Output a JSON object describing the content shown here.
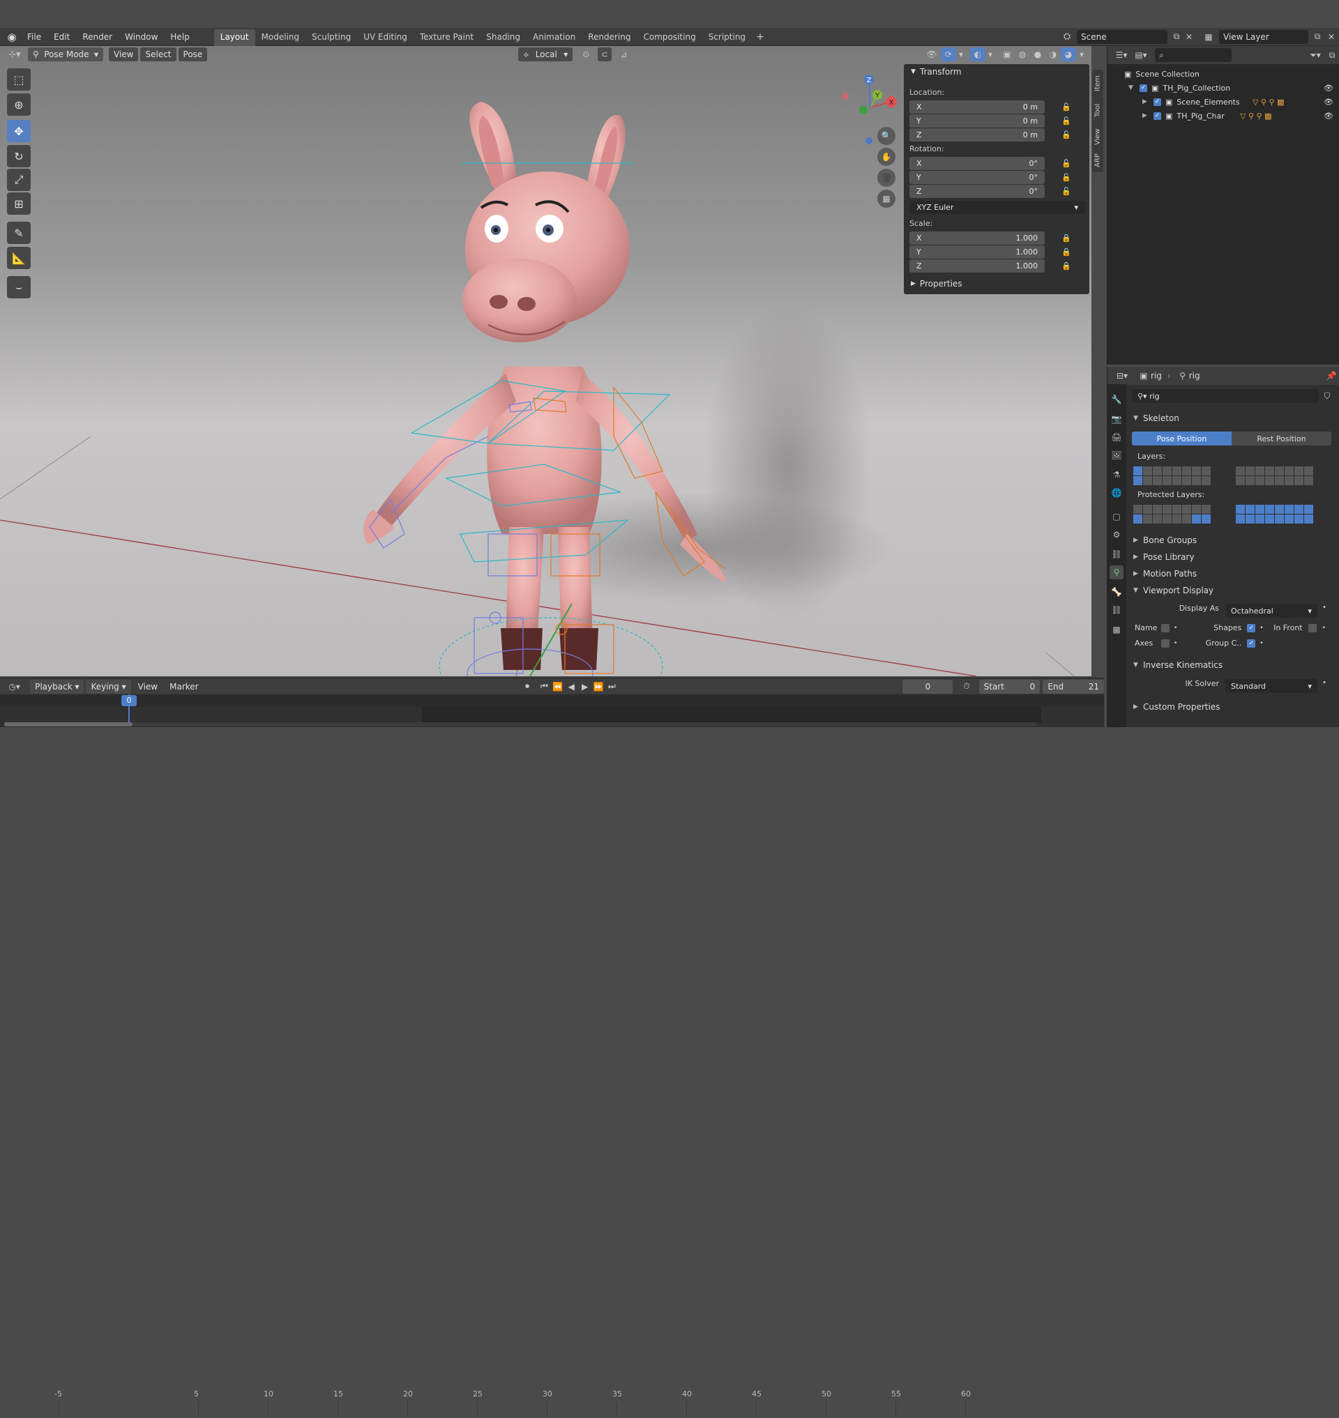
{
  "menus": [
    "File",
    "Edit",
    "Render",
    "Window",
    "Help"
  ],
  "workspaces": [
    {
      "label": "Layout",
      "active": true
    },
    {
      "label": "Modeling",
      "active": false
    },
    {
      "label": "Sculpting",
      "active": false
    },
    {
      "label": "UV Editing",
      "active": false
    },
    {
      "label": "Texture Paint",
      "active": false
    },
    {
      "label": "Shading",
      "active": false
    },
    {
      "label": "Animation",
      "active": false
    },
    {
      "label": "Rendering",
      "active": false
    },
    {
      "label": "Compositing",
      "active": false
    },
    {
      "label": "Scripting",
      "active": false
    }
  ],
  "workspace_add": "+",
  "scene_name": "Scene",
  "view_layer_name": "View Layer",
  "viewport_header": {
    "mode": "Pose Mode",
    "view": "View",
    "select": "Select",
    "pose": "Pose",
    "orientation": "Local"
  },
  "npanel": {
    "transform_title": "Transform",
    "location_label": "Location:",
    "location": [
      {
        "axis": "X",
        "value": "0 m"
      },
      {
        "axis": "Y",
        "value": "0 m"
      },
      {
        "axis": "Z",
        "value": "0 m"
      }
    ],
    "rotation_label": "Rotation:",
    "rotation": [
      {
        "axis": "X",
        "value": "0°"
      },
      {
        "axis": "Y",
        "value": "0°"
      },
      {
        "axis": "Z",
        "value": "0°"
      }
    ],
    "rotation_mode": "XYZ Euler",
    "scale_label": "Scale:",
    "scale": [
      {
        "axis": "X",
        "value": "1.000"
      },
      {
        "axis": "Y",
        "value": "1.000"
      },
      {
        "axis": "Z",
        "value": "1.000"
      }
    ],
    "properties_title": "Properties"
  },
  "side_tabs": [
    "Item",
    "Tool",
    "View",
    "ARP"
  ],
  "gizmo": {
    "x": "X",
    "y": "Y",
    "z": "Z"
  },
  "outliner": {
    "search_placeholder": "",
    "rows": [
      {
        "label": "Scene Collection",
        "indent": 0
      },
      {
        "label": "TH_Pig_Collection",
        "indent": 1
      },
      {
        "label": "Scene_Elements",
        "indent": 2
      },
      {
        "label": "TH_Pig_Char",
        "indent": 2
      }
    ]
  },
  "properties": {
    "breadcrumb_a": "rig",
    "breadcrumb_b": "rig",
    "data_name": "rig",
    "skeleton_title": "Skeleton",
    "pose_position": "Pose Position",
    "rest_position": "Rest Position",
    "layers_label": "Layers:",
    "protected_layers_label": "Protected Layers:",
    "collapsed_sections": [
      "Bone Groups",
      "Pose Library",
      "Motion Paths"
    ],
    "viewport_display_title": "Viewport Display",
    "display_as_label": "Display As",
    "display_as_value": "Octahedral",
    "name_label": "Name",
    "shapes_label": "Shapes",
    "in_front_label": "In Front",
    "axes_label": "Axes",
    "group_colors_label": "Group C..",
    "ik_title": "Inverse Kinematics",
    "ik_solver_label": "IK Solver",
    "ik_solver_value": "Standard",
    "custom_properties_title": "Custom Properties"
  },
  "timeline": {
    "playback": "Playback",
    "keying": "Keying",
    "view": "View",
    "marker": "Marker",
    "current_frame": "0",
    "start_label": "Start",
    "start_value": "0",
    "end_label": "End",
    "end_value": "21",
    "ruler": [
      "-5",
      "0",
      "5",
      "10",
      "15",
      "20",
      "25",
      "30",
      "35",
      "40",
      "45",
      "50",
      "55",
      "60"
    ],
    "playhead": "0"
  },
  "colors": {
    "accent": "#5680c2",
    "active_green": "#6fcf6f",
    "pig_skin": "#e8a9a6",
    "bone_orange": "#e07a2a",
    "bone_cyan": "#2ab8c8",
    "bone_blue": "#6f7fe0"
  }
}
